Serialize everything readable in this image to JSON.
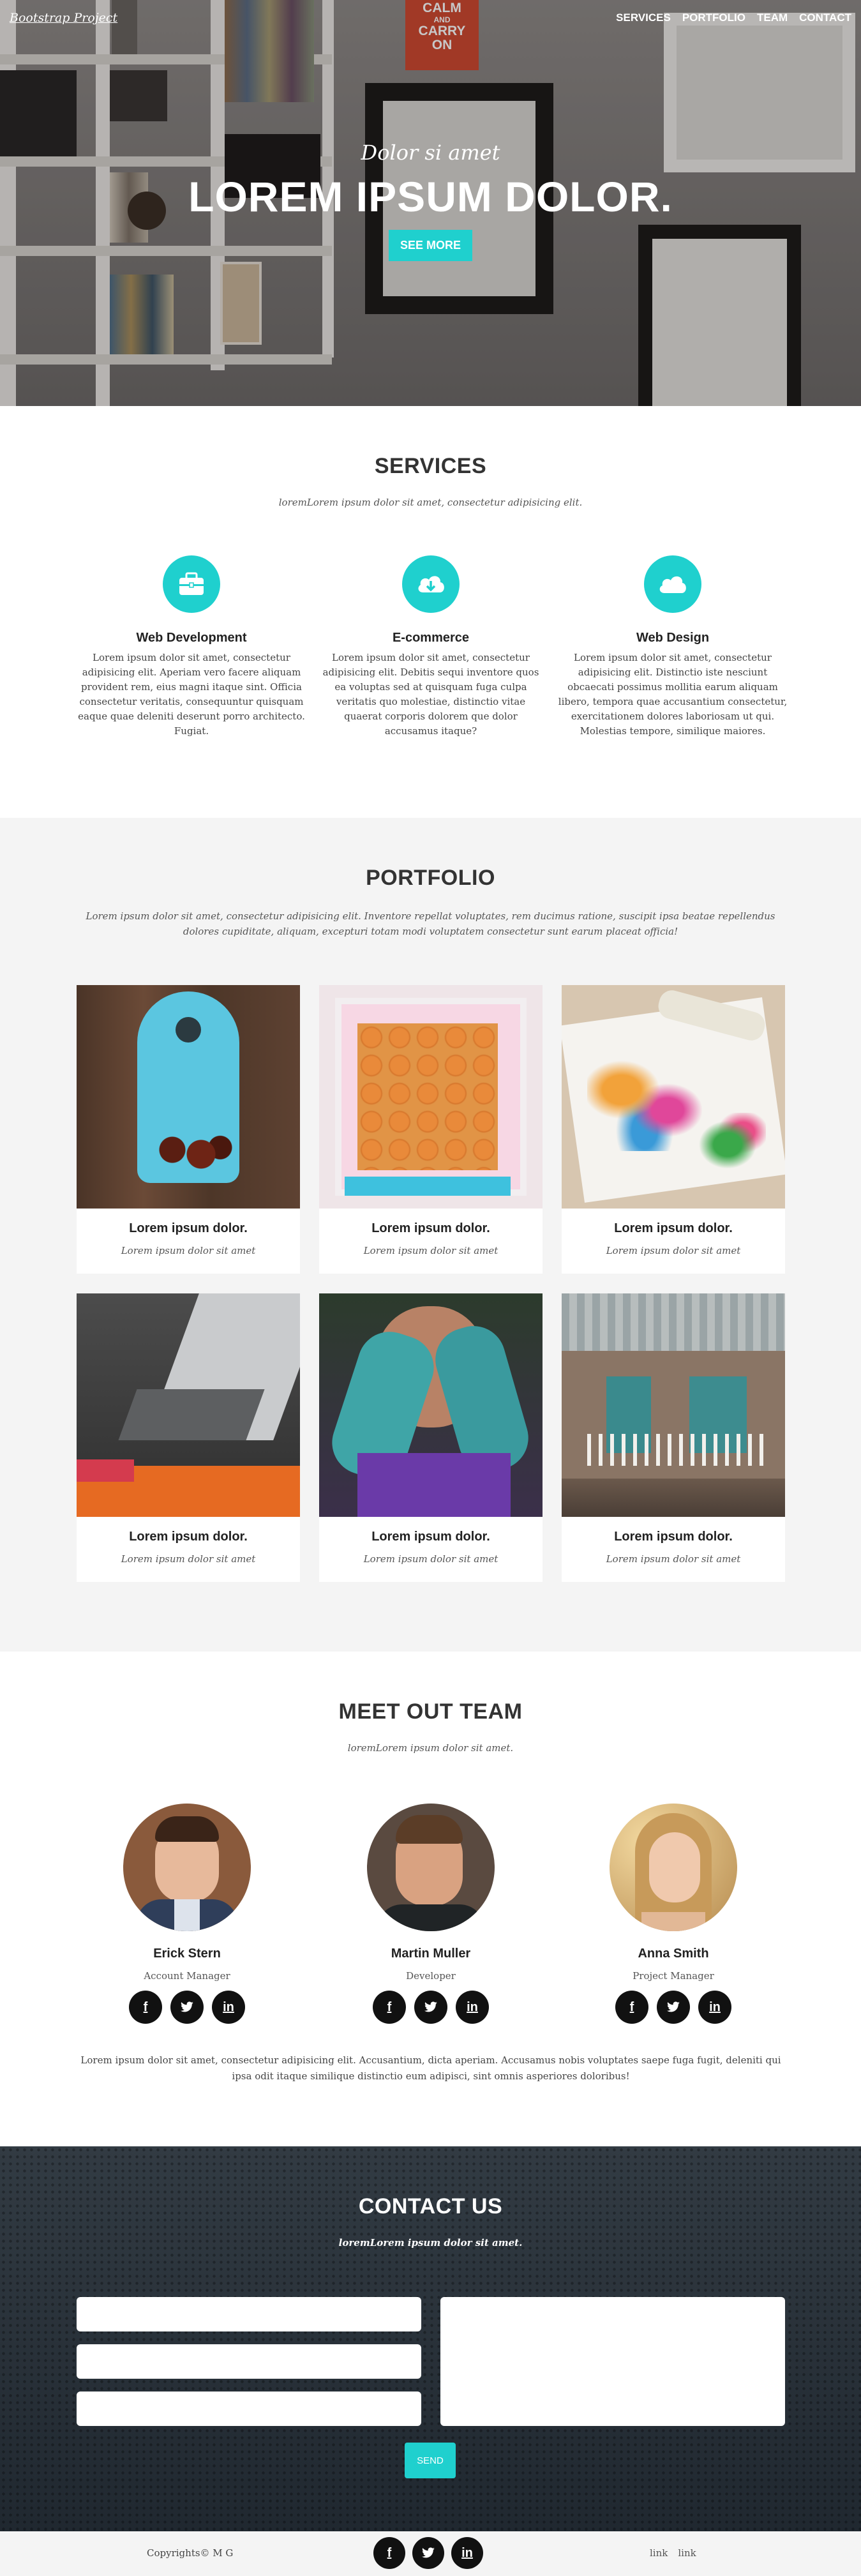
{
  "nav": {
    "brand": "Bootstrap Project",
    "links": [
      "SERVICES",
      "PORTFOLIO",
      "TEAM",
      "CONTACT"
    ]
  },
  "hero": {
    "poster": [
      "CALM",
      "AND",
      "CARRY",
      "ON"
    ],
    "subtitle": "Dolor si amet",
    "title": "LOREM IPSUM DOLOR.",
    "button": "SEE MORE"
  },
  "services": {
    "title": "SERVICES",
    "subtitle": "loremLorem ipsum dolor sit amet, consectetur adipisicing elit.",
    "items": [
      {
        "icon": "briefcase-icon",
        "name": "Web Development",
        "text": "Lorem ipsum dolor sit amet, consectetur adipisicing elit. Aperiam vero facere aliquam provident rem, eius magni itaque sint. Officia consectetur veritatis, consequuntur quisquam eaque quae deleniti deserunt porro architecto. Fugiat."
      },
      {
        "icon": "cloud-download-icon",
        "name": "E-commerce",
        "text": "Lorem ipsum dolor sit amet, consectetur adipisicing elit. Debitis sequi inventore quos ea voluptas sed at quisquam fuga culpa veritatis quo molestiae, distinctio vitae quaerat corporis dolorem que dolor accusamus itaque?"
      },
      {
        "icon": "cloud-icon",
        "name": "Web Design",
        "text": "Lorem ipsum dolor sit amet, consectetur adipisicing elit. Distinctio iste nesciunt obcaecati possimus mollitia earum aliquam libero, tempora quae accusantium consectetur, exercitationem dolores laboriosam ut qui. Molestias tempore, similique maiores."
      }
    ]
  },
  "portfolio": {
    "title": "PORTFOLIO",
    "subtitle": "Lorem ipsum dolor sit amet, consectetur adipisicing elit. Inventore repellat voluptates, rem ducimus ratione, suscipit ipsa beatae repellendus dolores cupiditate, aliquam, excepturi totam modi voluptatem consectetur sunt earum placeat officia!",
    "items": [
      {
        "title": "Lorem ipsum dolor.",
        "sub": "Lorem ipsum dolor sit amet"
      },
      {
        "title": "Lorem ipsum dolor.",
        "sub": "Lorem ipsum dolor sit amet"
      },
      {
        "title": "Lorem ipsum dolor.",
        "sub": "Lorem ipsum dolor sit amet"
      },
      {
        "title": "Lorem ipsum dolor.",
        "sub": "Lorem ipsum dolor sit amet"
      },
      {
        "title": "Lorem ipsum dolor.",
        "sub": "Lorem ipsum dolor sit amet"
      },
      {
        "title": "Lorem ipsum dolor.",
        "sub": "Lorem ipsum dolor sit amet"
      }
    ]
  },
  "team": {
    "title": "MEET OUT TEAM",
    "subtitle": "loremLorem ipsum dolor sit amet.",
    "members": [
      {
        "name": "Erick Stern",
        "role": "Account Manager"
      },
      {
        "name": "Martin Muller",
        "role": "Developer"
      },
      {
        "name": "Anna Smith",
        "role": "Project Manager"
      }
    ],
    "social": [
      "f",
      "t",
      "in"
    ],
    "text": "Lorem ipsum dolor sit amet, consectetur adipisicing elit. Accusantium, dicta aperiam. Accusamus nobis voluptates saepe fuga fugit, deleniti qui ipsa odit itaque similique distinctio eum adipisci, sint omnis asperiores doloribus!"
  },
  "contact": {
    "title": "CONTACT US",
    "subtitle": "loremLorem ipsum dolor sit amet.",
    "send": "SEND"
  },
  "footer": {
    "copyright": "Copyrights© M G",
    "links": [
      "link",
      "link"
    ]
  },
  "colors": {
    "accent": "#1fd0ce",
    "dark": "#2b333b",
    "light": "#f4f4f4"
  }
}
